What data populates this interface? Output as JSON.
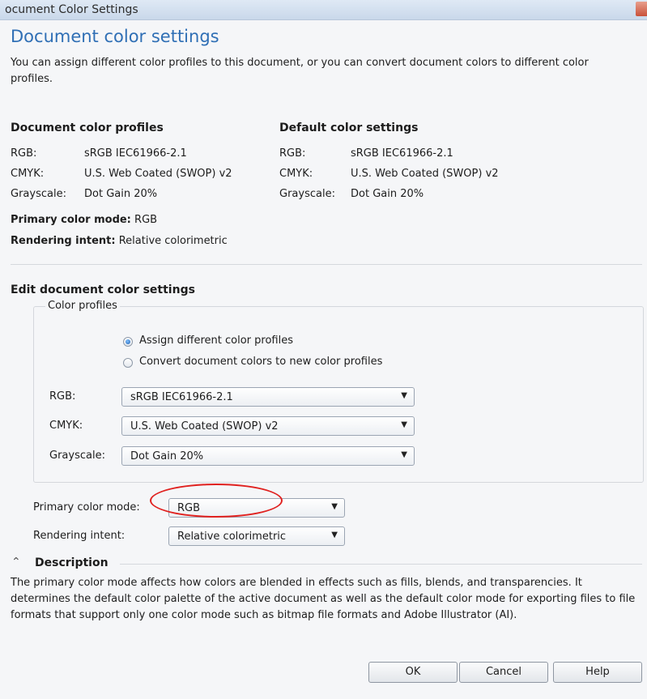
{
  "window": {
    "title": "ocument Color Settings"
  },
  "header": {
    "title": "Document color settings",
    "intro": "You can assign different color profiles to this document, or you can convert document colors to different color profiles."
  },
  "document_profiles": {
    "heading": "Document color profiles",
    "rgb_label": "RGB:",
    "rgb_value": "sRGB IEC61966-2.1",
    "cmyk_label": "CMYK:",
    "cmyk_value": "U.S. Web Coated (SWOP) v2",
    "gray_label": "Grayscale:",
    "gray_value": "Dot Gain 20%"
  },
  "default_settings": {
    "heading": "Default color settings",
    "rgb_label": "RGB:",
    "rgb_value": "sRGB IEC61966-2.1",
    "cmyk_label": "CMYK:",
    "cmyk_value": "U.S. Web Coated (SWOP) v2",
    "gray_label": "Grayscale:",
    "gray_value": "Dot Gain 20%"
  },
  "summary": {
    "primary_label": "Primary color mode:",
    "primary_value": "RGB",
    "rendering_label": "Rendering intent:",
    "rendering_value": "Relative colorimetric"
  },
  "edit": {
    "heading": "Edit document color settings",
    "group_title": "Color profiles",
    "radio_assign": "Assign different color profiles",
    "radio_convert": "Convert document colors to new color profiles",
    "rgb_label": "RGB:",
    "rgb_value": "sRGB IEC61966-2.1",
    "cmyk_label": "CMYK:",
    "cmyk_value": "U.S. Web Coated (SWOP) v2",
    "gray_label": "Grayscale:",
    "gray_value": "Dot Gain 20%",
    "primary_label": "Primary color mode:",
    "primary_value": "RGB",
    "rendering_label": "Rendering intent:",
    "rendering_value": "Relative colorimetric"
  },
  "description": {
    "heading": "Description",
    "text": "The primary color mode affects how colors are blended in effects such as fills, blends, and transparencies. It determines the default color palette of the active document as well as the default color mode for exporting files to file formats that support only one color mode such as bitmap file formats and Adobe Illustrator (AI)."
  },
  "buttons": {
    "ok": "OK",
    "cancel": "Cancel",
    "help": "Help"
  },
  "colors": {
    "heading_blue": "#2f6fb5",
    "highlight_ring": "#e0211f"
  }
}
